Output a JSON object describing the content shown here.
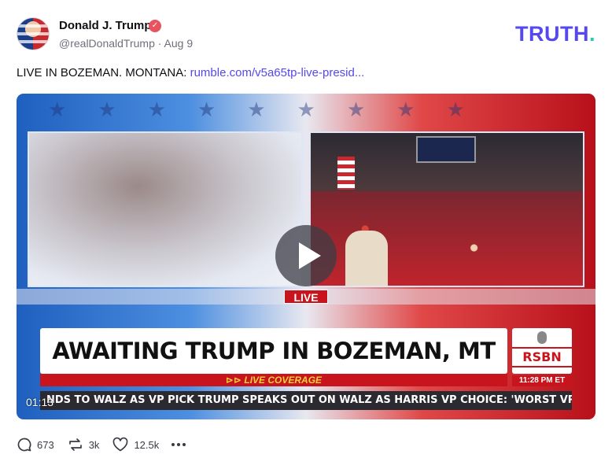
{
  "author": {
    "name": "Donald J. Trump",
    "handle_line": "@realDonaldTrump · Aug 9",
    "verified": true
  },
  "brand": {
    "logo_text": "TRUTH",
    "logo_dot": ".",
    "logo_color": "#5448ee",
    "dot_color": "#1fd1a8"
  },
  "post": {
    "text": "LIVE IN BOZEMAN. MONTANA: ",
    "link": "rumble.com/v5a65tp-live-presid..."
  },
  "video": {
    "live_badge": "LIVE",
    "headline": "AWAITING TRUMP IN BOZEMAN, MT",
    "live_coverage": "⊳⊳ LIVE COVERAGE",
    "network": "RSBN",
    "clock": "11:28 PM ET",
    "ticker": "NDS TO WALZ AS VP PICK     TRUMP SPEAKS OUT ON WALZ AS HARRIS VP CHOICE: 'WORST VP IN I",
    "timestamp": "01:13"
  },
  "actions": {
    "replies": "673",
    "retruths": "3k",
    "likes": "12.5k"
  }
}
